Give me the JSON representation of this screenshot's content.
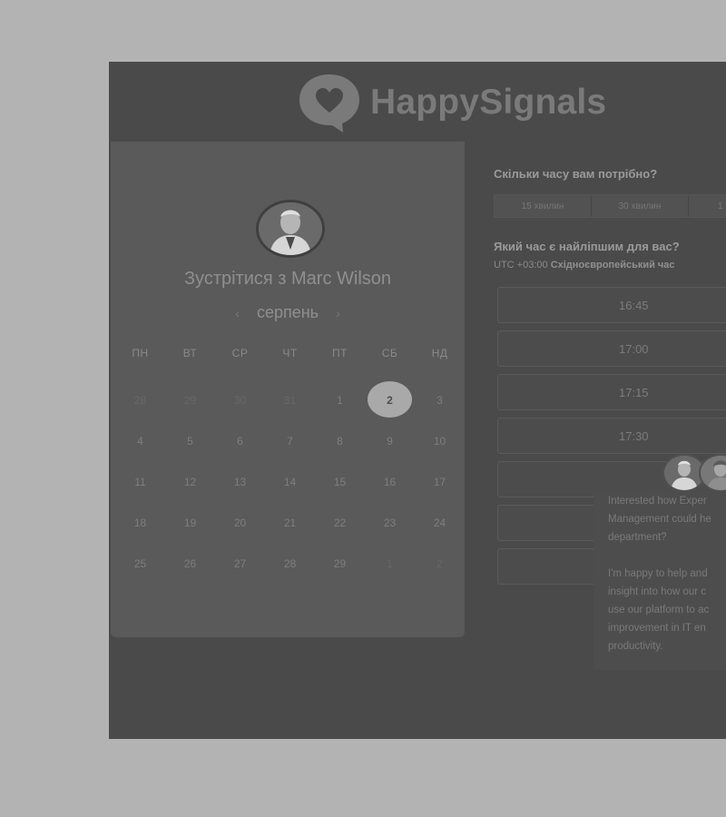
{
  "brand": {
    "name": "HappySignals"
  },
  "scheduler": {
    "title": "Зустрітися з Marc Wilson",
    "month": "серпень",
    "prev_icon": "‹",
    "next_icon": "›",
    "weekdays": [
      "ПН",
      "ВТ",
      "СР",
      "ЧТ",
      "ПТ",
      "СБ",
      "НД"
    ],
    "weeks": [
      [
        {
          "d": "28",
          "faded": true
        },
        {
          "d": "29",
          "faded": true
        },
        {
          "d": "30",
          "faded": true
        },
        {
          "d": "31",
          "faded": true
        },
        {
          "d": "1"
        },
        {
          "d": "2",
          "selected": true
        },
        {
          "d": "3"
        }
      ],
      [
        {
          "d": "4"
        },
        {
          "d": "5"
        },
        {
          "d": "6"
        },
        {
          "d": "7"
        },
        {
          "d": "8"
        },
        {
          "d": "9"
        },
        {
          "d": "10"
        }
      ],
      [
        {
          "d": "11"
        },
        {
          "d": "12"
        },
        {
          "d": "13"
        },
        {
          "d": "14"
        },
        {
          "d": "15"
        },
        {
          "d": "16"
        },
        {
          "d": "17"
        }
      ],
      [
        {
          "d": "18"
        },
        {
          "d": "19"
        },
        {
          "d": "20"
        },
        {
          "d": "21"
        },
        {
          "d": "22"
        },
        {
          "d": "23"
        },
        {
          "d": "24"
        }
      ],
      [
        {
          "d": "25"
        },
        {
          "d": "26"
        },
        {
          "d": "27"
        },
        {
          "d": "28"
        },
        {
          "d": "29"
        },
        {
          "d": "1",
          "faded": true
        },
        {
          "d": "2",
          "faded": true
        }
      ]
    ]
  },
  "booking": {
    "duration_question": "Скільки часу вам потрібно?",
    "durations": [
      "15 хвилин",
      "30 хвилин",
      "1"
    ],
    "time_question": "Який час є найліпшим для вас?",
    "tz_offset": "UTC +03:00",
    "tz_name": "Східноєвропейський час",
    "slots": [
      "16:45",
      "17:00",
      "17:15",
      "17:30",
      "",
      "",
      ""
    ]
  },
  "chat": {
    "message_1": "Interested how Exper\nManagement could he\ndepartment?",
    "message_2": "I'm happy to help and\ninsight into how our c\nuse our platform to ac\nimprovement in IT en\nproductivity."
  }
}
